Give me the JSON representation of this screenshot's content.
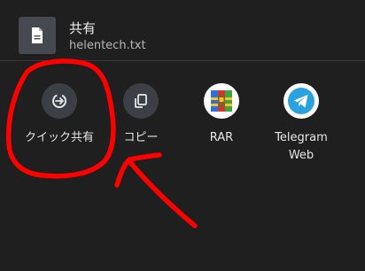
{
  "header": {
    "title": "共有",
    "filename": "helentech.txt",
    "file_icon": "document-icon"
  },
  "share_targets": [
    {
      "label": "クイック共有",
      "icon": "quick-share-icon",
      "icon_bg": "#3c4046"
    },
    {
      "label": "コピー",
      "icon": "copy-icon",
      "icon_bg": "#3c4046"
    },
    {
      "label": "RAR",
      "icon": "rar-app-icon",
      "icon_bg": "#ffffff"
    },
    {
      "label": "Telegram Web",
      "icon": "telegram-icon",
      "icon_bg": "#ffffff"
    }
  ],
  "annotation": {
    "color": "#ff0000",
    "shapes": "circle-and-arrow"
  },
  "colors": {
    "background": "#1f1f1f",
    "telegram_blue": "#2aa2df"
  }
}
